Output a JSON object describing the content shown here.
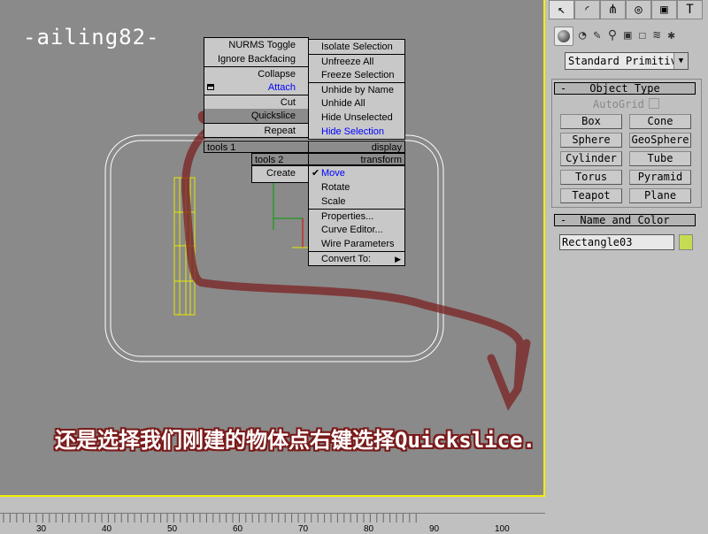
{
  "watermark": "-ailing82-",
  "quad_left": {
    "items": [
      "NURMS Toggle",
      "Ignore Backfacing",
      "Collapse",
      "Attach",
      "Cut",
      "Quickslice",
      "Repeat"
    ],
    "label": "tools 1"
  },
  "quad_left2": {
    "label": "tools 2",
    "items": [
      "Create"
    ]
  },
  "quad_right_top": {
    "label": "display",
    "items": [
      "Isolate Selection",
      "Unfreeze All",
      "Freeze Selection",
      "Unhide by Name",
      "Unhide All",
      "Hide Unselected",
      "Hide Selection"
    ]
  },
  "quad_right_bottom": {
    "label": "transform",
    "items": [
      "Move",
      "Rotate",
      "Scale",
      "Properties...",
      "Curve Editor...",
      "Wire Parameters",
      "Convert To:"
    ]
  },
  "panel": {
    "dropdown": "Standard Primitiv",
    "object_type": {
      "title": "Object Type",
      "autogrid": "AutoGrid",
      "buttons": [
        "Box",
        "Cone",
        "Sphere",
        "GeoSphere",
        "Cylinder",
        "Tube",
        "Torus",
        "Pyramid",
        "Teapot",
        "Plane"
      ]
    },
    "name_color": {
      "title": "Name and Color",
      "name": "Rectangle03",
      "color": "#c4dc50"
    }
  },
  "subtitle": "还是选择我们刚建的物体点右键选择Quickslice.",
  "ruler": [
    "30",
    "40",
    "50",
    "60",
    "70",
    "80",
    "90",
    "100"
  ]
}
